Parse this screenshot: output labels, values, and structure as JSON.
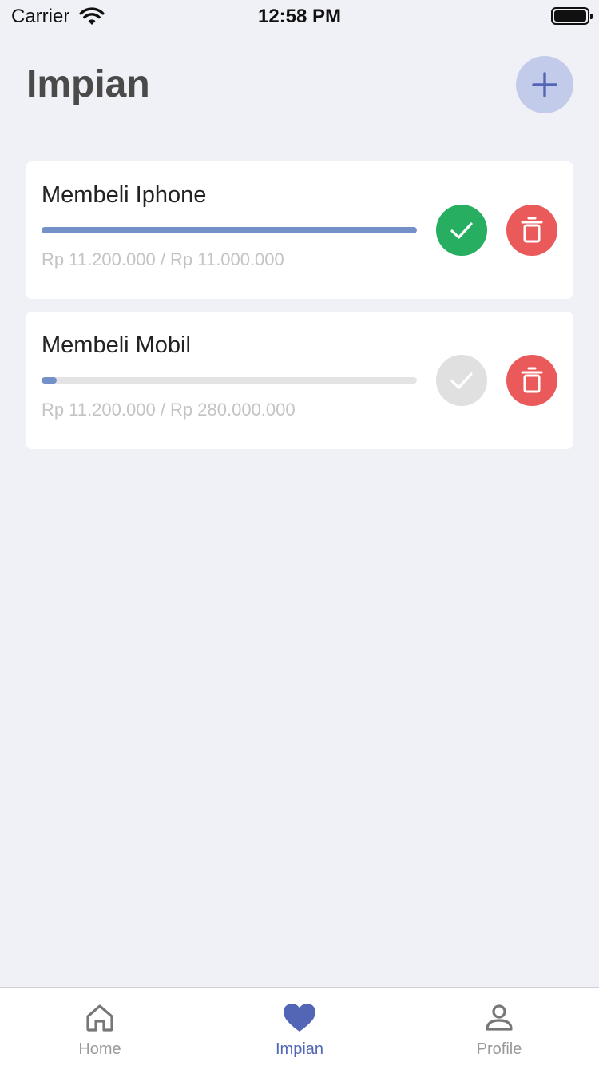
{
  "status_bar": {
    "carrier": "Carrier",
    "time": "12:58 PM"
  },
  "header": {
    "title": "Impian",
    "add_icon": "plus-icon"
  },
  "dreams": [
    {
      "title": "Membeli Iphone",
      "amount_text": "Rp 11.200.000 / Rp 11.000.000",
      "progress": 1.0,
      "completed": true,
      "check_icon": "check-icon",
      "delete_icon": "trash-icon"
    },
    {
      "title": "Membeli Mobil",
      "amount_text": "Rp 11.200.000 / Rp 280.000.000",
      "progress": 0.04,
      "completed": false,
      "check_icon": "check-icon",
      "delete_icon": "trash-icon"
    }
  ],
  "tabs": [
    {
      "label": "Home",
      "icon": "home-icon",
      "active": false
    },
    {
      "label": "Impian",
      "icon": "heart-icon",
      "active": true
    },
    {
      "label": "Profile",
      "icon": "user-icon",
      "active": false
    }
  ],
  "colors": {
    "background": "#f0f1f6",
    "accent": "#5366b6",
    "progress": "#7391c8",
    "success": "#27ae60",
    "disabled": "#e0e0e0",
    "danger": "#eb5a5a",
    "add_button_bg": "#c3cbea"
  }
}
